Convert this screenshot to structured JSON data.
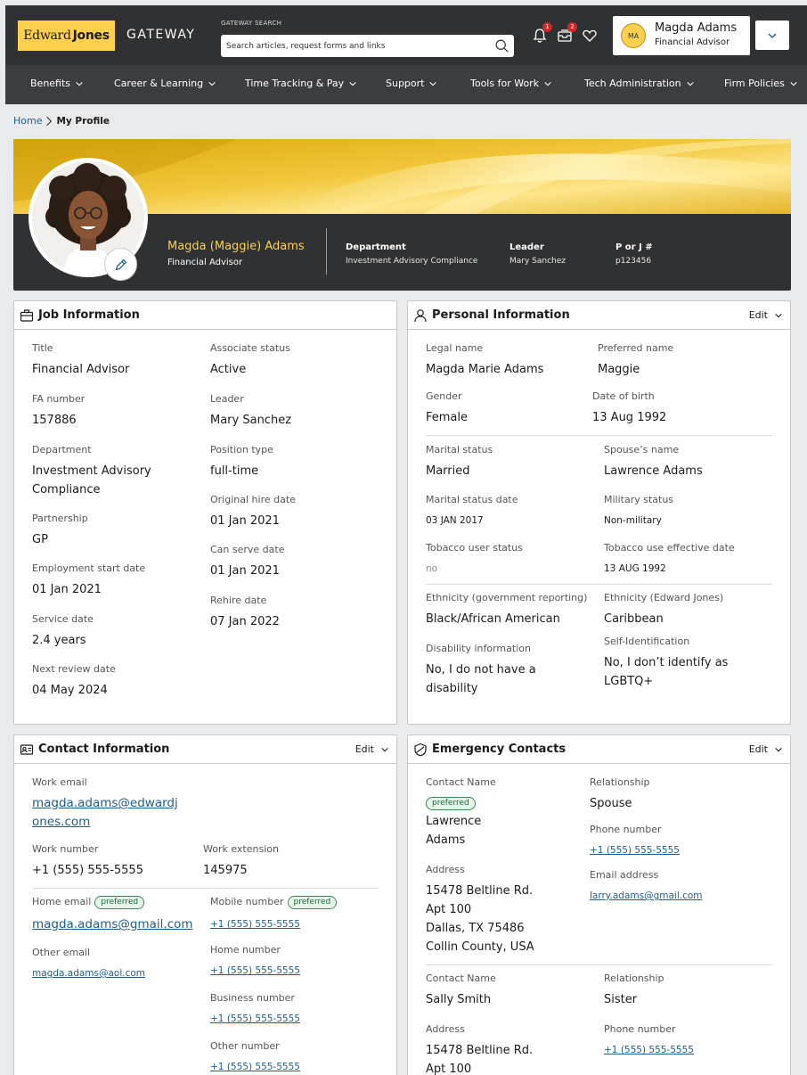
{
  "header": {
    "logo_word1": "Edward",
    "logo_word2": "Jones",
    "app_name": "GATEWAY",
    "search_label": "GATEWAY SEARCH",
    "search_placeholder": "Search articles, request forms and links",
    "notifications_count": "1",
    "inbox_count": "2",
    "user_initials": "MA",
    "user_name": "Magda Adams",
    "user_role": "Financial Advisor"
  },
  "nav": {
    "items": [
      "Benefits",
      "Career & Learning",
      "Time Tracking & Pay",
      "Support",
      "Tools for Work",
      "Tech Administration",
      "Firm Policies"
    ]
  },
  "breadcrumb": {
    "home": "Home",
    "current": "My Profile"
  },
  "profile": {
    "name": "Magda (Maggie) Adams",
    "title": "Financial Advisor",
    "department_label": "Department",
    "department": "Investment Advisory Compliance",
    "leader_label": "Leader",
    "leader": "Mary Sanchez",
    "id_label": "P or J #",
    "id": "p123456"
  },
  "job": {
    "title": "Job Information",
    "title_label": "Title",
    "title_value": "Financial Advisor",
    "fa_label": "FA number",
    "fa_value": "157886",
    "dept_label": "Department",
    "dept_value_1": "Investment Advisory",
    "dept_value_2": "Compliance",
    "partnership_label": "Partnership",
    "partnership_value": "GP",
    "emp_start_label": "Employment start date",
    "emp_start_value": "01 Jan 2021",
    "service_label": "Service date",
    "service_value": "2.4 years",
    "review_label": "Next review date",
    "review_value": "04 May 2024",
    "assoc_label": "Associate status",
    "assoc_value": "Active",
    "leader_label": "Leader",
    "leader_value": "Mary Sanchez",
    "position_label": "Position type",
    "position_value": "full-time",
    "hire_label": "Original hire date",
    "hire_value": "01 Jan 2021",
    "canserve_label": "Can serve date",
    "canserve_value": "01 Jan 2021",
    "rehire_label": "Rehire date",
    "rehire_value": "07 Jan 2022"
  },
  "personal": {
    "title": "Personal Information",
    "edit": "Edit",
    "legal_label": "Legal name",
    "legal_value": "Magda Marie Adams",
    "preferred_label": "Preferred name",
    "preferred_value": "Maggie",
    "gender_label": "Gender",
    "gender_value": "Female",
    "dob_label": "Date of birth",
    "dob_value": "13 Aug 1992",
    "marital_label": "Marital status",
    "marital_value": "Married",
    "spouse_label": "Spouse’s name",
    "spouse_value": "Lawrence Adams",
    "marital_date_label": "Marital status date",
    "marital_date_value": "03 JAN 2017",
    "military_label": "Military status",
    "military_value": "Non-military",
    "tobacco_label": "Tobacco user status",
    "tobacco_value": "no",
    "tobacco_date_label": "Tobacco use effective date",
    "tobacco_date_value": "13 AUG 1992",
    "eth_gov_label": "Ethnicity (government reporting)",
    "eth_gov_value": "Black/African American",
    "eth_ej_label": "Ethnicity (Edward Jones)",
    "eth_ej_value": "Caribbean",
    "disability_label": "Disability information",
    "disability_value_1": "No, I do not have a",
    "disability_value_2": "disability",
    "selfid_label": "Self-Identification",
    "selfid_value_1": "No, I don’t identify as",
    "selfid_value_2": "LGBTQ+"
  },
  "contact": {
    "title": "Contact Information",
    "edit": "Edit",
    "work_email_label": "Work email",
    "work_email_1": "magda.adams@edwardj",
    "work_email_2": "ones.com",
    "work_number_label": "Work number",
    "work_number": "+1 (555) 555-5555",
    "work_ext_label": "Work extension",
    "work_ext": "145975",
    "home_email_label": "Home email",
    "preferred_tag": "preferred",
    "home_email": "magda.adams@gmail.com",
    "other_email_label": "Other email",
    "other_email": "magda.adams@aol.com",
    "mobile_label": "Mobile number",
    "mobile": "+1 (555) 555-5555",
    "home_number_label": "Home number",
    "home_number": "+1 (555) 555-5555",
    "business_label": "Business number",
    "business": "+1 (555) 555-5555",
    "other_number_label": "Other number",
    "other_number": "+1 (555) 555-5555"
  },
  "emergency": {
    "title": "Emergency Contacts",
    "edit": "Edit",
    "c1_name_label": "Contact Name",
    "c1_tag": "preferred",
    "c1_name_1": "Lawrence",
    "c1_name_2": "Adams",
    "c1_rel_label": "Relationship",
    "c1_rel": "Spouse",
    "c1_phone_label": "Phone number",
    "c1_phone": "+1 (555) 555-5555",
    "c1_email_label": "Email address",
    "c1_email": "larry.adams@gmail.com",
    "c1_addr_label": "Address",
    "c1_addr_1": "15478 Beltline Rd.",
    "c1_addr_2": "Apt 100",
    "c1_addr_3": "Dallas, TX 75486",
    "c1_addr_4": "Collin County, USA",
    "c2_name_label": "Contact Name",
    "c2_name": "Sally Smith",
    "c2_rel_label": "Relationship",
    "c2_rel": "Sister",
    "c2_addr_label": "Address",
    "c2_addr_1": "15478 Beltline Rd.",
    "c2_addr_2": "Apt 100",
    "c2_phone_label": "Phone number",
    "c2_phone": "+1 (555) 555-5555"
  },
  "colors": {
    "brand_yellow": "#fcd04d",
    "header_dark": "#2f3133",
    "link_blue": "#1d5e8e",
    "badge_red": "#d42626",
    "preferred_green": "#3a8a57"
  }
}
